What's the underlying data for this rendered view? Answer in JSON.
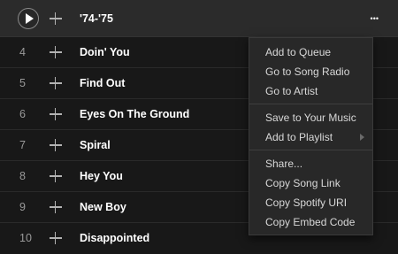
{
  "tracks": [
    {
      "title": "'74-'75"
    },
    {
      "num": "4",
      "title": "Doin' You"
    },
    {
      "num": "5",
      "title": "Find Out"
    },
    {
      "num": "6",
      "title": "Eyes On The Ground"
    },
    {
      "num": "7",
      "title": "Spiral"
    },
    {
      "num": "8",
      "title": "Hey You"
    },
    {
      "num": "9",
      "title": "New Boy"
    },
    {
      "num": "10",
      "title": "Disappointed"
    }
  ],
  "more_label": "•••",
  "context_menu": {
    "items": [
      "Add to Queue",
      "Go to Song Radio",
      "Go to Artist",
      "Save to Your Music",
      "Add to Playlist",
      "Share...",
      "Copy Song Link",
      "Copy Spotify URI",
      "Copy Embed Code"
    ]
  },
  "icons": {
    "play": "play-icon",
    "add": "plus-icon",
    "more": "more-options-icon",
    "submenu": "chevron-right-icon"
  },
  "colors": {
    "background": "#181818",
    "active_row": "#2b2b2b",
    "menu_bg": "#282828",
    "text": "#ffffff",
    "muted": "#9a9a9a"
  }
}
